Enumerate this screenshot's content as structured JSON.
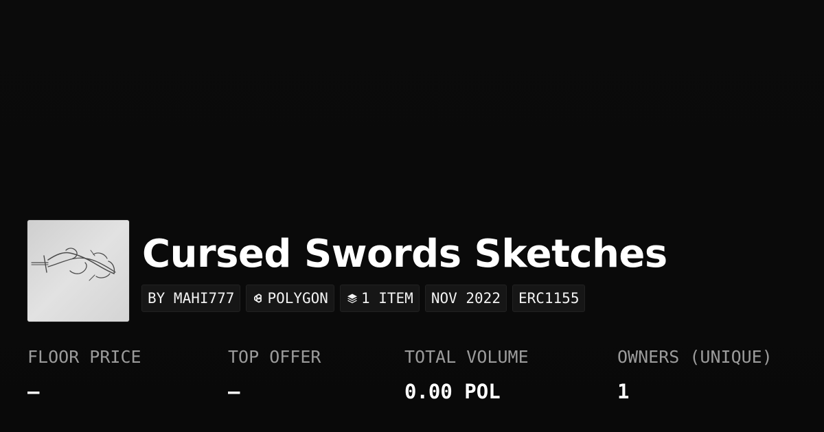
{
  "collection": {
    "title": "Cursed Swords Sketches",
    "thumbnail_icon": "sword-sketch-image"
  },
  "chips": [
    {
      "label": "BY MAHI777",
      "icon": ""
    },
    {
      "label": "POLYGON",
      "icon": "polygon-icon"
    },
    {
      "label": "1 ITEM",
      "icon": "layers-icon"
    },
    {
      "label": "NOV 2022",
      "icon": ""
    },
    {
      "label": "ERC1155",
      "icon": ""
    }
  ],
  "stats": [
    {
      "label": "FLOOR PRICE",
      "value": "–"
    },
    {
      "label": "TOP OFFER",
      "value": "–"
    },
    {
      "label": "TOTAL VOLUME",
      "value": "0.00 POL"
    },
    {
      "label": "OWNERS (UNIQUE)",
      "value": "1"
    }
  ],
  "colors": {
    "background": "#0b0b0b",
    "text": "#ffffff",
    "muted": "#9b9b9b",
    "chip_bg": "#161616"
  }
}
